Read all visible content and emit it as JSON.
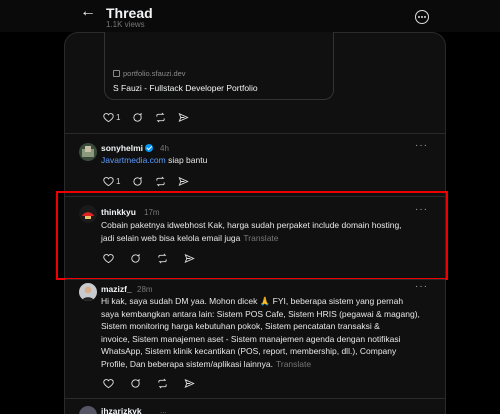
{
  "header": {
    "title": "Thread",
    "views": "1.1K views",
    "back_icon": "arrow-left-icon",
    "more_icon": "more-circle-icon"
  },
  "link_card": {
    "domain": "portfolio.sfauzi.dev",
    "title": "S Fauzi - Fullstack Developer Portfolio"
  },
  "post0": {
    "likes": "1"
  },
  "reply1": {
    "username": "sonyhelmi",
    "time": "4h",
    "link": "Javartmedia.com",
    "text": " siap bantu",
    "likes": "1"
  },
  "reply2": {
    "username": "thinkkyu",
    "time": "17m",
    "text_line1": "Cobain paketnya idwebhost Kak, harga sudah perpaket include domain hosting,",
    "text_line2": "jadi selain web bisa kelola email juga",
    "translate": "Translate"
  },
  "reply3": {
    "username": "mazizf_",
    "time": "28m",
    "lines": [
      "Hi kak, saya sudah DM yaa. Mohon dicek 🙏 FYI, beberapa sistem yang pernah",
      "saya kembangkan antara lain: Sistem POS Cafe, Sistem HRIS (pegawai & magang),",
      "Sistem monitoring harga kebutuhan pokok, Sistem pencatatan transaksi &",
      "invoice, Sistem manajemen aset - Sistem manajemen agenda dengan notifikasi",
      "WhatsApp, Sistem klinik kecantikan (POS, report, membership, dll.), Company",
      "Profile, Dan beberapa sistem/aplikasi lainnya."
    ],
    "translate": "Translate"
  },
  "reply4": {
    "username": "ihzarizkyk",
    "time": "..."
  },
  "colors": {
    "background": "#000000",
    "panel": "#101010",
    "link": "#5b9bff",
    "verified": "#0095f6",
    "highlight": "#ee0000"
  }
}
